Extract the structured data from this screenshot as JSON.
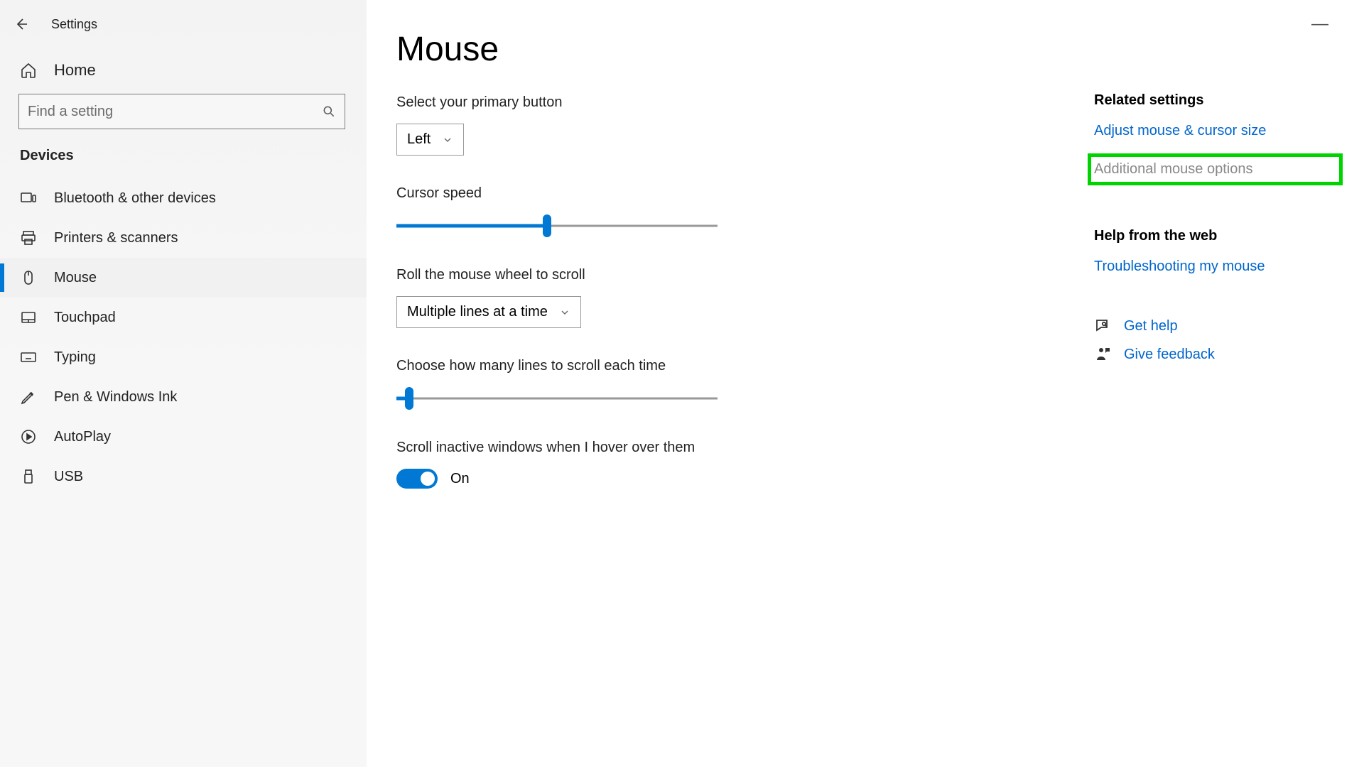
{
  "window": {
    "title": "Settings",
    "minimize": "—"
  },
  "sidebar": {
    "home": "Home",
    "search_placeholder": "Find a setting",
    "section": "Devices",
    "items": [
      {
        "label": "Bluetooth & other devices"
      },
      {
        "label": "Printers & scanners"
      },
      {
        "label": "Mouse"
      },
      {
        "label": "Touchpad"
      },
      {
        "label": "Typing"
      },
      {
        "label": "Pen & Windows Ink"
      },
      {
        "label": "AutoPlay"
      },
      {
        "label": "USB"
      }
    ]
  },
  "main": {
    "heading": "Mouse",
    "primary_button": {
      "label": "Select your primary button",
      "value": "Left"
    },
    "cursor_speed": {
      "label": "Cursor speed",
      "percent": 47
    },
    "wheel_scroll": {
      "label": "Roll the mouse wheel to scroll",
      "value": "Multiple lines at a time"
    },
    "lines_scroll": {
      "label": "Choose how many lines to scroll each time",
      "percent": 4
    },
    "hover_scroll": {
      "label": "Scroll inactive windows when I hover over them",
      "state": "On"
    }
  },
  "right": {
    "related_header": "Related settings",
    "link_adjust": "Adjust mouse & cursor size",
    "link_additional": "Additional mouse options",
    "help_header": "Help from the web",
    "link_troubleshoot": "Troubleshooting my mouse",
    "get_help": "Get help",
    "give_feedback": "Give feedback"
  }
}
